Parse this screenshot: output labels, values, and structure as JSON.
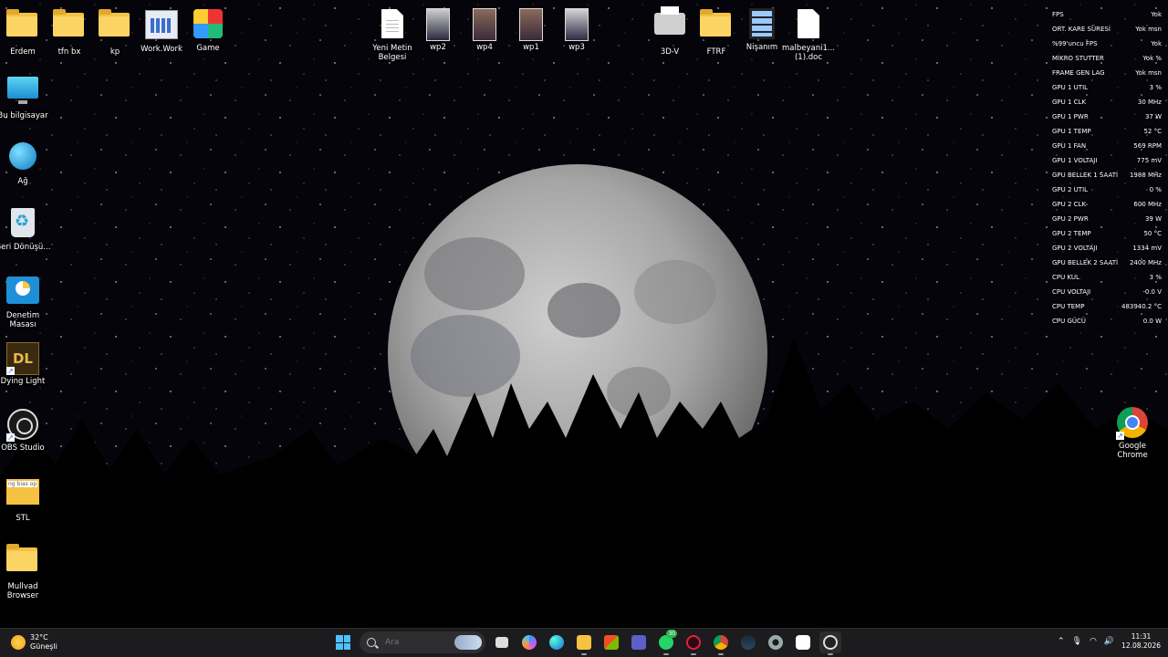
{
  "desktop": {
    "icons": {
      "erdem": "Erdem",
      "tfn": "tfn bx",
      "kp": "kp",
      "work": "Work.Work",
      "game": "Game",
      "yeni_metin": "Yeni Metin Belgesi",
      "wp2": "wp2",
      "wp4": "wp4",
      "wp1": "wp1",
      "wp3": "wp3",
      "threed": "3D-V",
      "ftrf": "FTRF",
      "nisanim": "Nişanım",
      "malbeyani": "malbeyani1... (1).doc",
      "bu_bilgisayar": "Bu bilgisayar",
      "ag": "Ağ",
      "geri": "Geri Dönüşü...",
      "denetim": "Denetim Masası",
      "dying": "Dying Light",
      "obs": "OBS Studio",
      "stl": "STL",
      "mullvad": "Mullvad Browser",
      "chrome": "Google Chrome"
    }
  },
  "overlay": {
    "rows": [
      {
        "label": "FPS",
        "value": "Yok"
      },
      {
        "label": "ORT. KARE SÜRESİ",
        "value": "Yok msn"
      },
      {
        "label": "%99'uncu FPS",
        "value": "Yok"
      },
      {
        "label": "MİKRO STUTTER",
        "value": "Yok %"
      },
      {
        "label": "FRAME GEN LAG",
        "value": "Yok msn"
      },
      {
        "label": "GPU 1 UTIL",
        "value": "3 %"
      },
      {
        "label": "GPU 1 CLK",
        "value": "30 MHz"
      },
      {
        "label": "GPU 1 PWR",
        "value": "37 W"
      },
      {
        "label": "GPU 1 TEMP",
        "value": "52 °C"
      },
      {
        "label": "GPU 1 FAN",
        "value": "569 RPM"
      },
      {
        "label": "GPU 1 VOLTAJI",
        "value": "775 mV"
      },
      {
        "label": "GPU BELLEK 1 SAATİ",
        "value": "1988 MHz"
      },
      {
        "label": "GPU 2 UTIL",
        "value": "0 %"
      },
      {
        "label": "GPU 2 CLK",
        "value": "600 MHz"
      },
      {
        "label": "GPU 2 PWR",
        "value": "39 W"
      },
      {
        "label": "GPU 2 TEMP",
        "value": "50 °C"
      },
      {
        "label": "GPU 2 VOLTAJI",
        "value": "1334 mV"
      },
      {
        "label": "GPU BELLEK 2 SAATİ",
        "value": "2400 MHz"
      },
      {
        "label": "CPU KUL",
        "value": "3 %"
      },
      {
        "label": "CPU VOLTAJI",
        "value": "-0.0 V"
      },
      {
        "label": "CPU TEMP",
        "value": "483940.2 °C"
      },
      {
        "label": "CPU GÜCÜ",
        "value": "0.0 W"
      }
    ]
  },
  "taskbar": {
    "weather": {
      "temp": "32°C",
      "desc": "Güneşli"
    },
    "search": {
      "placeholder": "Ara"
    },
    "whatsapp_badge": "30",
    "clock": {
      "time": "11:31",
      "date": "12.08.2026"
    },
    "colors": {
      "accent": "#4cc2ff",
      "bar": "#1c1c1e"
    }
  }
}
